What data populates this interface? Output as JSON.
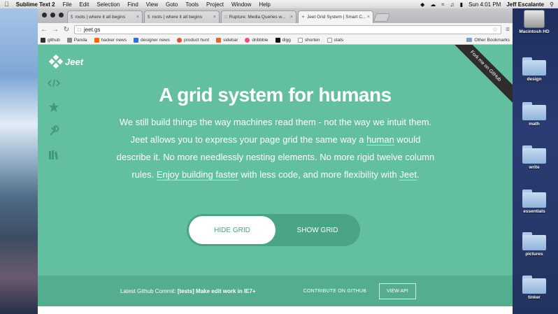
{
  "menubar": {
    "app_name": "Sublime Text 2",
    "items": [
      "File",
      "Edit",
      "Selection",
      "Find",
      "View",
      "Goto",
      "Tools",
      "Project",
      "Window",
      "Help"
    ],
    "clock": "Sun 4:01 PM",
    "user": "Jeff Escalante"
  },
  "browser": {
    "tabs": [
      {
        "title": "roots | where it all begins",
        "active": false
      },
      {
        "title": "roots | where it all begins",
        "active": false
      },
      {
        "title": "Rupture: Media Queries w...",
        "active": false
      },
      {
        "title": "Jeet Grid System | Smart C...",
        "active": true
      }
    ],
    "url": "jeet.gs",
    "bookmarks": [
      {
        "label": "github",
        "color": "#333333"
      },
      {
        "label": "Panda",
        "color": "#888888"
      },
      {
        "label": "hacker news",
        "color": "#ff6600"
      },
      {
        "label": "designer news",
        "color": "#2d72d9"
      },
      {
        "label": "product hunt",
        "color": "#da552f"
      },
      {
        "label": "sidebar",
        "color": "#e8692e"
      },
      {
        "label": "dribbble",
        "color": "#ea4c89"
      },
      {
        "label": "digg",
        "color": "#111111"
      },
      {
        "label": "shorten",
        "color": "#cccccc"
      },
      {
        "label": "stats",
        "color": "#cccccc"
      }
    ],
    "other_bookmarks": "Other Bookmarks"
  },
  "page": {
    "logo": "Jeet",
    "ribbon": "Fork me on GitHub",
    "headline": "A grid system for humans",
    "lead": {
      "p1": "We still build things the way machines read them - not the way we intuit them. Jeet allows you to express your page grid the same way a ",
      "human": "human",
      "p2": " would describe it. No more needlessly nesting elements. No more rigid twelve column rules. ",
      "enjoy": "Enjoy building faster",
      "p3": " with less code, and more flexibility with ",
      "jeet": "Jeet",
      "p4": "."
    },
    "toggle": {
      "hide": "HIDE GRID",
      "show": "SHOW GRID"
    },
    "footer": {
      "commit_label": "Latest Github Commit: ",
      "commit_msg": "[tests] Make edit work in IE7+",
      "contribute": "CONTRIBUTE ON GITHUB",
      "view_api": "VIEW API"
    },
    "colors": {
      "accent": "#62bf9f",
      "accent_dark": "#49a585",
      "footer": "#55ad8f"
    }
  },
  "desktop": {
    "icons": [
      {
        "label": "Macintosh HD",
        "kind": "hd-icon"
      },
      {
        "label": "design",
        "kind": "folder-icon"
      },
      {
        "label": "math",
        "kind": "folder-icon"
      },
      {
        "label": "write",
        "kind": "folder-icon"
      },
      {
        "label": "essentials",
        "kind": "folder-icon"
      },
      {
        "label": "pictures",
        "kind": "folder-icon"
      },
      {
        "label": "tinker",
        "kind": "folder-icon"
      }
    ]
  }
}
